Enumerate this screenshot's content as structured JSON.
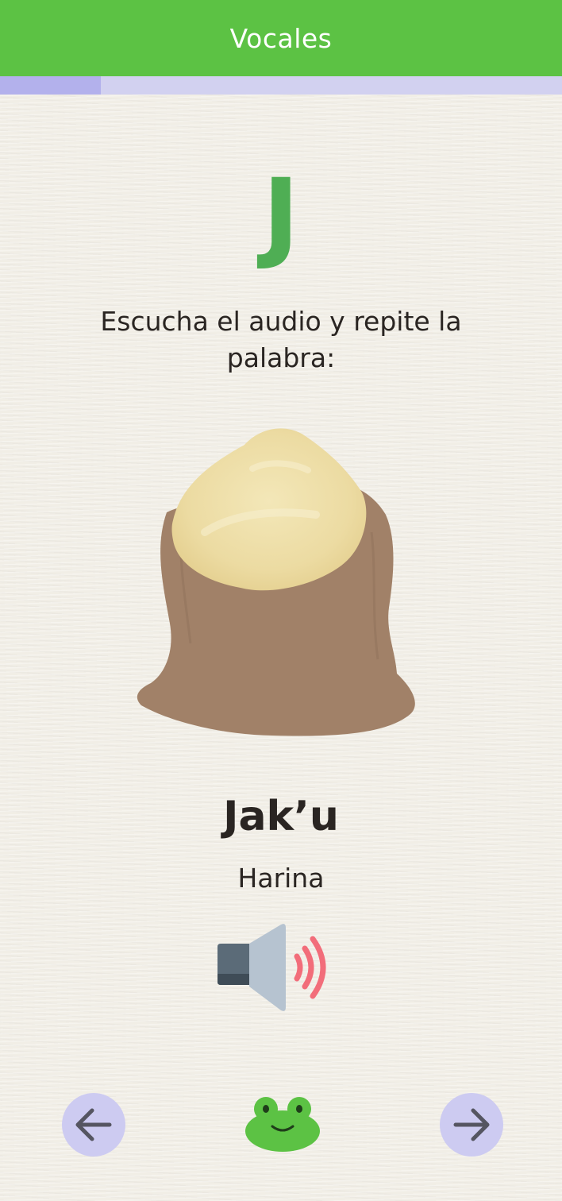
{
  "header": {
    "title": "Vocales"
  },
  "progress": {
    "fraction": 0.18
  },
  "lesson": {
    "letter": "J",
    "instruction": "Escucha el audio y repite la palabra:",
    "image": "sack-of-flour",
    "word": "Jak’u",
    "translation": "Harina"
  },
  "audio": {
    "icon": "speaker-icon"
  },
  "navigation": {
    "prev_icon": "arrow-left-icon",
    "next_icon": "arrow-right-icon",
    "home_icon": "frog-mascot-icon"
  },
  "colors": {
    "header": "#5cc244",
    "letter": "#4fae54",
    "progress_track": "#d2d1f0",
    "progress_fill": "#b3b1ec",
    "nav_button": "#cdcbf1",
    "speaker_waves": "#f26d7a",
    "mascot": "#5cc244"
  }
}
